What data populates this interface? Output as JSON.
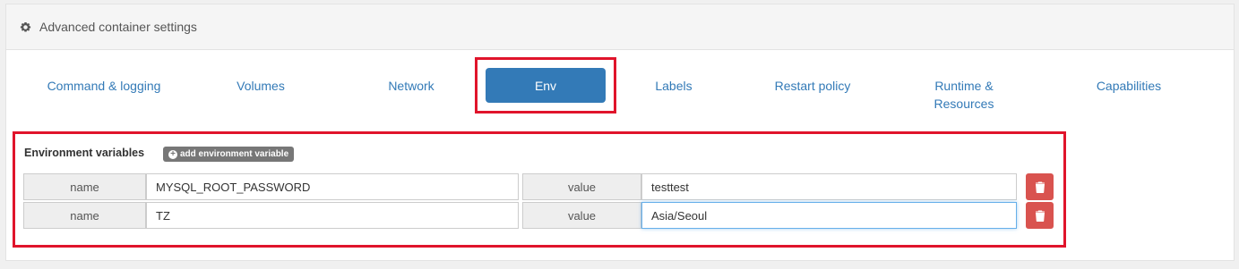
{
  "header": {
    "title": "Advanced container settings",
    "icon": "gear-icon"
  },
  "tabs": [
    {
      "label": "Command & logging"
    },
    {
      "label": "Volumes"
    },
    {
      "label": "Network"
    },
    {
      "label": "Env",
      "active": true
    },
    {
      "label": "Labels"
    },
    {
      "label": "Restart policy"
    },
    {
      "label": "Runtime & Resources"
    },
    {
      "label": "Capabilities"
    }
  ],
  "env": {
    "section_label": "Environment variables",
    "add_button_label": "add environment variable",
    "rows": [
      {
        "name_label": "name",
        "name": "MYSQL_ROOT_PASSWORD",
        "value_label": "value",
        "value": "testtest"
      },
      {
        "name_label": "name",
        "name": "TZ",
        "value_label": "value",
        "value": "Asia/Seoul"
      }
    ]
  },
  "colors": {
    "accent": "#337ab7",
    "highlight": "#e0142b",
    "danger": "#d9534f"
  }
}
